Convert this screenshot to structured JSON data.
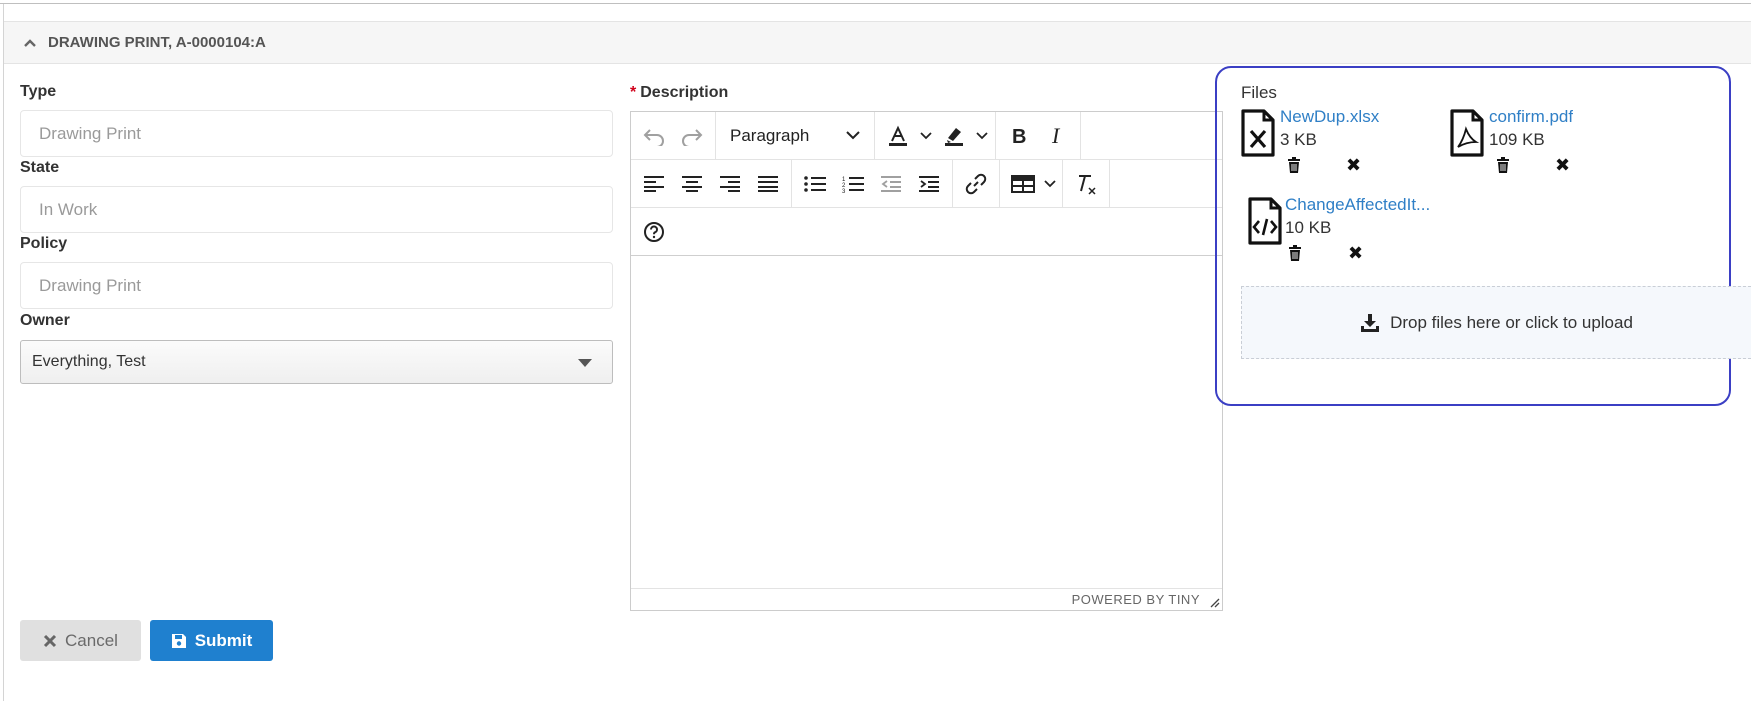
{
  "section": {
    "title": "DRAWING PRINT, A-0000104:A"
  },
  "form": {
    "type": {
      "label": "Type",
      "value": "Drawing Print"
    },
    "state": {
      "label": "State",
      "value": "In Work"
    },
    "policy": {
      "label": "Policy",
      "value": "Drawing Print"
    },
    "owner": {
      "label": "Owner",
      "value": "Everything, Test"
    }
  },
  "description": {
    "required_mark": "*",
    "label": "Description",
    "format_select": "Paragraph",
    "status": "POWERED BY TINY"
  },
  "files": {
    "title": "Files",
    "items": [
      {
        "name": "NewDup.xlsx",
        "size": "3 KB",
        "icon": "excel-file-icon"
      },
      {
        "name": "confirm.pdf",
        "size": "109 KB",
        "icon": "pdf-file-icon"
      },
      {
        "name": "ChangeAffectedIt...",
        "size": "10 KB",
        "icon": "code-file-icon"
      }
    ],
    "dropzone_label": "Drop files here or click to upload"
  },
  "actions": {
    "cancel": "Cancel",
    "submit": "Submit"
  },
  "colors": {
    "accent": "#1f80cf",
    "link": "#2f7fc6",
    "highlight_border": "#3b3fc4"
  }
}
